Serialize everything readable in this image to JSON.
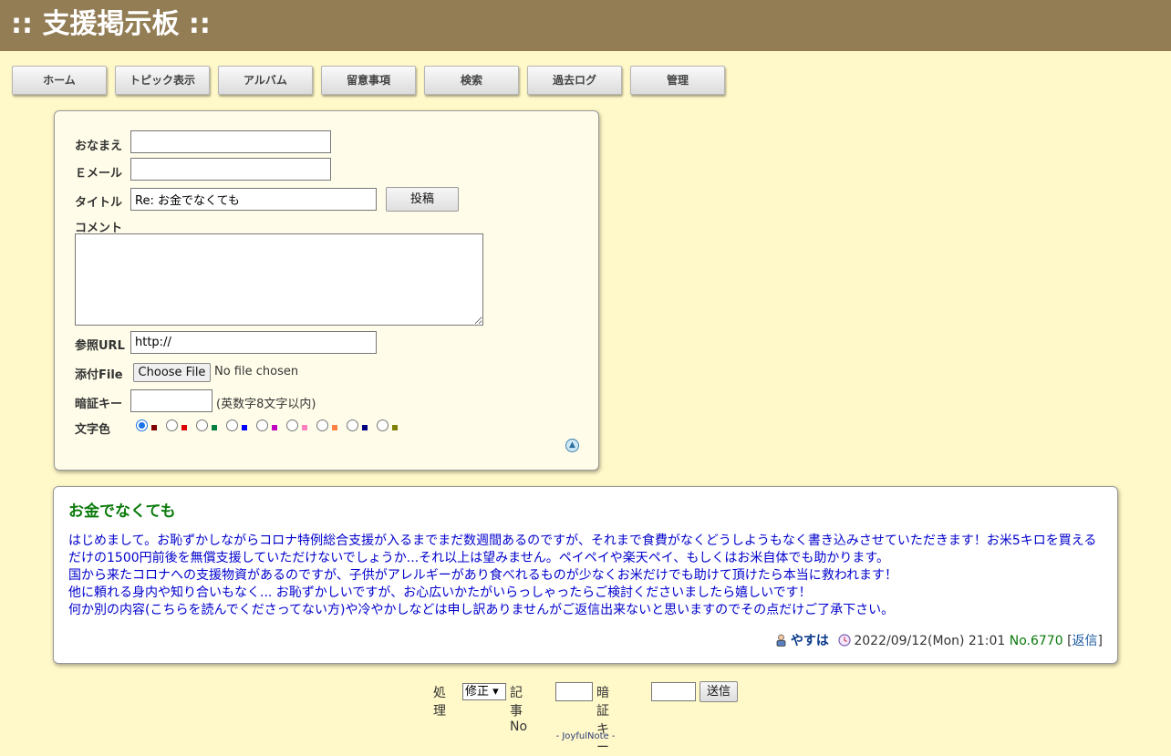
{
  "header": {
    "title": ":: 支援掲示板 ::"
  },
  "nav": [
    {
      "label": "ホーム"
    },
    {
      "label": "トピック表示"
    },
    {
      "label": "アルバム"
    },
    {
      "label": "留意事項"
    },
    {
      "label": "検索"
    },
    {
      "label": "過去ログ"
    },
    {
      "label": "管理"
    }
  ],
  "form": {
    "name_label": "おなまえ",
    "name_value": "",
    "email_label": "Ｅメール",
    "email_value": "",
    "title_label": "タイトル",
    "title_value": "Re: お金でなくても",
    "post_button": "投稿",
    "comment_label": "コメント",
    "url_label": "参照URL",
    "url_value": "http://",
    "file_label": "添付File",
    "file_button": "Choose File",
    "file_status": "No file chosen",
    "password_label": "暗証キー",
    "password_note": "(英数字8文字以内)",
    "color_label": "文字色",
    "colors": [
      "#800000",
      "#df0000",
      "#008040",
      "#0000ff",
      "#c100c1",
      "#ff80c0",
      "#ff8040",
      "#000080",
      "#808000"
    ],
    "selected_color_index": 0
  },
  "article": {
    "title": "お金でなくても",
    "body": [
      "はじめまして。お恥ずかしながらコロナ特例総合支援が入るまでまだ数週間あるのですが、それまで食費がなくどうしようもなく書き込みさせていただきます！お米5キロを買えるだけの1500円前後を無償支援していただけないでしょうか...それ以上は望みません。ペイペイや楽天ペイ、もしくはお米自体でも助かります。",
      "国から来たコロナへの支援物資があるのですが、子供がアレルギーがあり食べれるものが少なくお米だけでも助けて頂けたら本当に救われます！",
      "他に頼れる身内や知り合いもなく... お恥ずかしいですが、お心広いかたがいらっしゃったらご検討くださいましたら嬉しいです！",
      "何か別の内容(こちらを読んでくださってない方)や冷やかしなどは申し訳ありませんがご返信出来ないと思いますのでその点だけご了承下さい。"
    ],
    "author": "やすは",
    "date": "2022/09/12(Mon) 21:01",
    "number": "No.6770",
    "reply_open": "[",
    "reply_label": "返信",
    "reply_close": "]"
  },
  "bottom": {
    "process_label": "処理",
    "process_value": "修正",
    "article_no_label": "記事No",
    "password_label": "暗証キー",
    "send_label": "送信"
  },
  "footer": {
    "text": "- JoyfulNote -"
  }
}
